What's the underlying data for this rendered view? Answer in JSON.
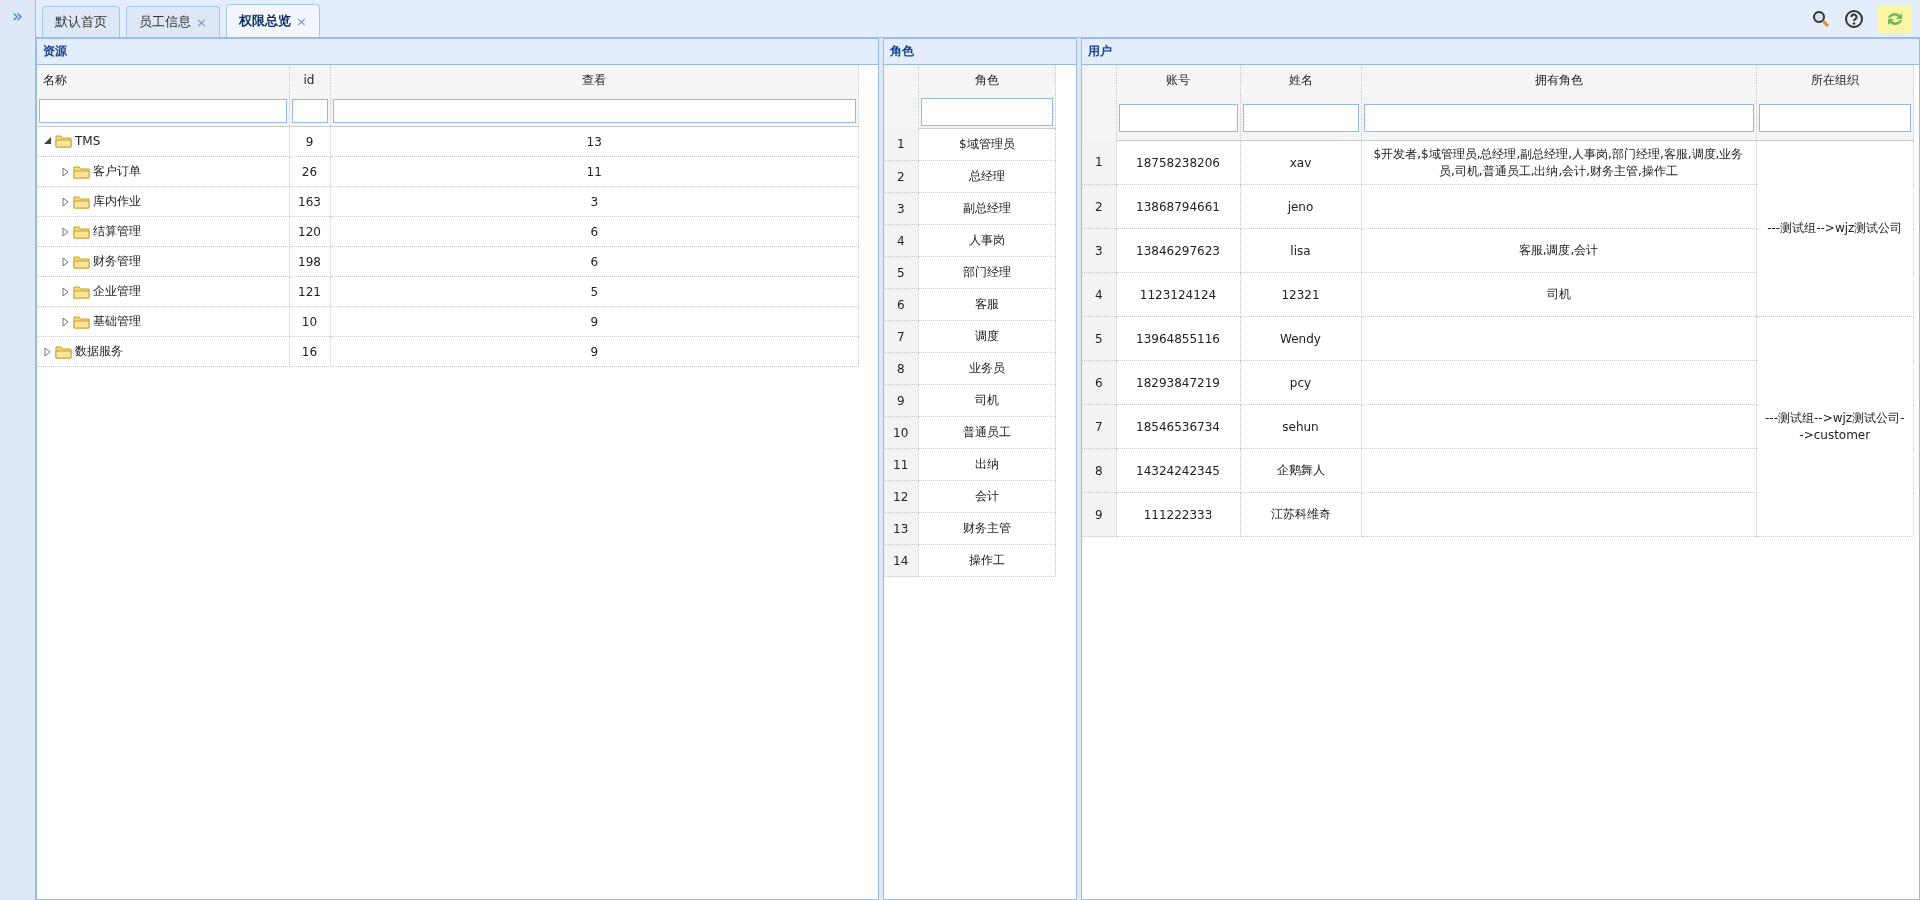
{
  "sidebar_toggle": "»",
  "tabs": [
    {
      "label": "默认首页",
      "selected": false
    },
    {
      "label": "员工信息",
      "close": "×",
      "selected": false
    },
    {
      "label": "权限总览",
      "close": "×",
      "selected": true
    }
  ],
  "resources": {
    "title": "资源",
    "columns": [
      "名称",
      "id",
      "查看"
    ],
    "tree": [
      {
        "name": "TMS",
        "id": "9",
        "view": "13",
        "expanded": true,
        "children": [
          {
            "name": "客户订单",
            "id": "26",
            "view": "11",
            "expanded": false
          },
          {
            "name": "库内作业",
            "id": "163",
            "view": "3",
            "expanded": false
          },
          {
            "name": "结算管理",
            "id": "120",
            "view": "6",
            "expanded": false
          },
          {
            "name": "财务管理",
            "id": "198",
            "view": "6",
            "expanded": false
          },
          {
            "name": "企业管理",
            "id": "121",
            "view": "5",
            "expanded": false
          },
          {
            "name": "基础管理",
            "id": "10",
            "view": "9",
            "expanded": false
          }
        ]
      },
      {
        "name": "数据服务",
        "id": "16",
        "view": "9",
        "expanded": false
      }
    ]
  },
  "roles": {
    "title": "角色",
    "column": "角色",
    "rows": [
      {
        "no": "1",
        "role": "$域管理员"
      },
      {
        "no": "2",
        "role": "总经理"
      },
      {
        "no": "3",
        "role": "副总经理"
      },
      {
        "no": "4",
        "role": "人事岗"
      },
      {
        "no": "5",
        "role": "部门经理"
      },
      {
        "no": "6",
        "role": "客服"
      },
      {
        "no": "7",
        "role": "调度"
      },
      {
        "no": "8",
        "role": "业务员"
      },
      {
        "no": "9",
        "role": "司机"
      },
      {
        "no": "10",
        "role": "普通员工"
      },
      {
        "no": "11",
        "role": "出纳"
      },
      {
        "no": "12",
        "role": "会计"
      },
      {
        "no": "13",
        "role": "财务主管"
      },
      {
        "no": "14",
        "role": "操作工"
      }
    ]
  },
  "users": {
    "title": "用户",
    "columns": [
      "账号",
      "姓名",
      "拥有角色",
      "所在组织"
    ],
    "org_groups": [
      {
        "org": "---测试组-->wjz测试公司",
        "rows": [
          {
            "no": "1",
            "account": "18758238206",
            "name": "xav",
            "roles": "$开发者,$域管理员,总经理,副总经理,人事岗,部门经理,客服,调度,业务员,司机,普通员工,出纳,会计,财务主管,操作工"
          },
          {
            "no": "2",
            "account": "13868794661",
            "name": "jeno"
          },
          {
            "no": "3",
            "account": "13846297623",
            "name": "lisa",
            "roles": "客服,调度,会计"
          },
          {
            "no": "4",
            "account": "1123124124",
            "name": "12321",
            "roles": "司机"
          }
        ]
      },
      {
        "org": "---测试组-->wjz测试公司-->customer",
        "rows": [
          {
            "no": "5",
            "account": "13964855116",
            "name": "Wendy"
          },
          {
            "no": "6",
            "account": "18293847219",
            "name": "pcy"
          },
          {
            "no": "7",
            "account": "18546536734",
            "name": "sehun"
          },
          {
            "no": "8",
            "account": "14324242345",
            "name": "企鹅舞人"
          },
          {
            "no": "9",
            "account": "111222333",
            "name": "江苏科维奇"
          }
        ]
      }
    ]
  }
}
